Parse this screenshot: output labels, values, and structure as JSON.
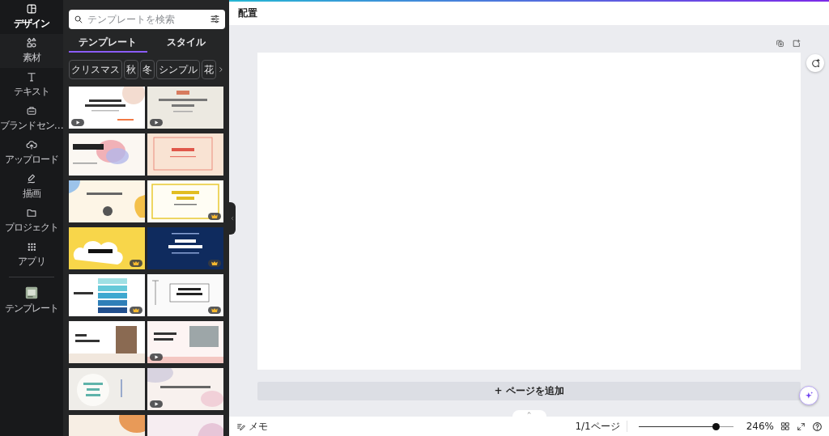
{
  "rail": {
    "items": [
      {
        "label": "デザイン",
        "selected": true
      },
      {
        "label": "素材",
        "selected": false
      },
      {
        "label": "テキスト",
        "selected": false
      },
      {
        "label": "ブランドセン…",
        "selected": false
      },
      {
        "label": "アップロード",
        "selected": false
      },
      {
        "label": "描画",
        "selected": false
      },
      {
        "label": "プロジェクト",
        "selected": false
      },
      {
        "label": "アプリ",
        "selected": false
      },
      {
        "label": "テンプレート",
        "selected": false
      }
    ]
  },
  "search": {
    "placeholder": "テンプレートを検索"
  },
  "tabs": [
    {
      "label": "テンプレート",
      "selected": true
    },
    {
      "label": "スタイル",
      "selected": false
    }
  ],
  "chips": [
    "クリスマス",
    "秋",
    "冬",
    "シンプル",
    "花"
  ],
  "templates": [
    {
      "color": "#ffffff",
      "kind": "video"
    },
    {
      "color": "#ece9e1",
      "kind": "video"
    },
    {
      "color": "#fbf7f2",
      "kind": "plain"
    },
    {
      "color": "#f9e3d3",
      "kind": "plain"
    },
    {
      "color": "#fdf5e6",
      "kind": "plain"
    },
    {
      "color": "#fffdf4",
      "kind": "premium"
    },
    {
      "color": "#f8d64a",
      "kind": "premium"
    },
    {
      "color": "#0f2b5e",
      "kind": "premium"
    },
    {
      "color": "#ffffff",
      "kind": "premium"
    },
    {
      "color": "#fafafa",
      "kind": "premium"
    },
    {
      "color": "#ffffff",
      "kind": "plain"
    },
    {
      "color": "#fdf4f3",
      "kind": "video"
    },
    {
      "color": "#efede9",
      "kind": "plain"
    },
    {
      "color": "#f8f1ee",
      "kind": "video"
    },
    {
      "color": "#f7eee4",
      "kind": "plain"
    },
    {
      "color": "#f6edf1",
      "kind": "plain"
    }
  ],
  "top_bar": {
    "label": "配置"
  },
  "canvas": {
    "add_page": "+ ページを追加"
  },
  "status_bar": {
    "notes": "メモ",
    "pages": "1/1ページ",
    "zoom": {
      "level": 0.82
    },
    "zoom_reading": "246%"
  }
}
